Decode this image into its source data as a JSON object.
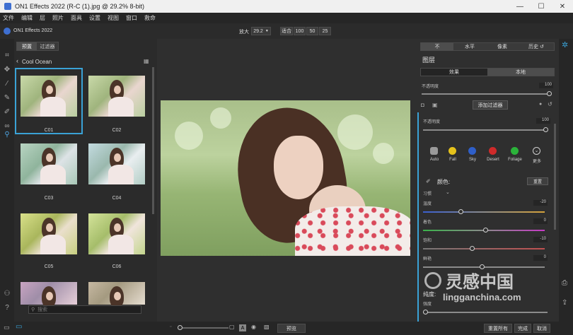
{
  "window": {
    "title": "ON1 Effects 2022 (R-C (1).jpg @ 29.2% 8-bit)",
    "min": "—",
    "max": "☐",
    "close": "✕"
  },
  "menu": [
    "文件",
    "编辑",
    "层",
    "照片",
    "面具",
    "设置",
    "视图",
    "窗口",
    "救命"
  ],
  "toolbar": {
    "app_name": "ON1 Effects 2022",
    "zoom_label": "放大",
    "zoom_value": "29.2",
    "fit_label": "适合",
    "zoom_100": "100",
    "zoom_50": "50",
    "zoom_25": "25"
  },
  "browser": {
    "tab_presets": "预置",
    "tab_filters": "过滤器",
    "category": "Cool Ocean",
    "thumbnails": [
      "C01",
      "C02",
      "C03",
      "C04",
      "C05",
      "C06"
    ],
    "search_placeholder": "搜索"
  },
  "right_panel": {
    "tabs": [
      "不",
      "水平",
      "像素",
      "历史 ↺"
    ],
    "layers_title": "图层",
    "effects_tab": "效果",
    "local_tab": "本地",
    "opacity_label": "不透明度",
    "opacity_value": "100",
    "add_filter": "添加过滤器",
    "filter_opacity_label": "不透明度",
    "filter_opacity_value": "100",
    "presets": [
      {
        "name": "Auto",
        "color": "#9a9a9a"
      },
      {
        "name": "Fall",
        "color": "#e5c21b"
      },
      {
        "name": "Sky",
        "color": "#2f5fc9"
      },
      {
        "name": "Desert",
        "color": "#cf2a2a"
      },
      {
        "name": "Foliage",
        "color": "#2bb33a"
      },
      {
        "name": "更多",
        "color": "#cfcfcf"
      }
    ],
    "color_section": "颜色:",
    "reset_button": "重置",
    "mode_label": "习惯",
    "sliders": [
      {
        "label": "温度",
        "value": "-20"
      },
      {
        "label": "着色",
        "value": "0"
      },
      {
        "label": "饱和",
        "value": "-10"
      },
      {
        "label": "鲜艳",
        "value": "0"
      }
    ],
    "section_label_2": "纯度:",
    "section_sub_2": "强度"
  },
  "status": {
    "preview": "预览",
    "keep_all": "重置所有",
    "done": "完成",
    "cancel": "取消",
    "zoom_percent_label": "A"
  },
  "watermark": {
    "text_cn": "灵感中国",
    "text_url": "lingganchina.com"
  }
}
